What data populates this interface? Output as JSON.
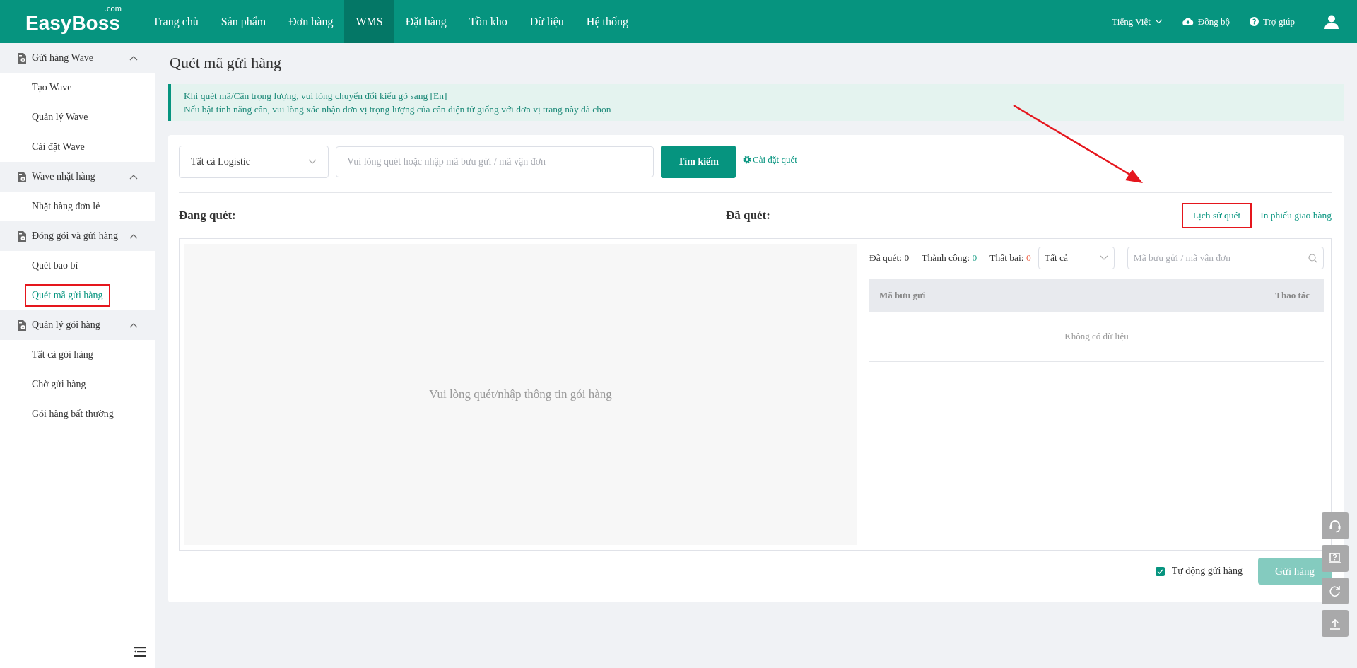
{
  "header": {
    "logo": "EasyBoss",
    "logo_suffix": ".com",
    "nav": [
      {
        "label": "Trang chủ",
        "selected": false
      },
      {
        "label": "Sản phẩm",
        "selected": false
      },
      {
        "label": "Đơn hàng",
        "selected": false
      },
      {
        "label": "WMS",
        "selected": true
      },
      {
        "label": "Đặt hàng",
        "selected": false
      },
      {
        "label": "Tồn kho",
        "selected": false
      },
      {
        "label": "Dữ liệu",
        "selected": false
      },
      {
        "label": "Hệ thống",
        "selected": false
      }
    ],
    "language": "Tiếng Việt",
    "sync": "Đồng bộ",
    "help": "Trợ giúp"
  },
  "sidebar": {
    "groups": [
      {
        "title": "Gửi hàng Wave",
        "expanded": true,
        "items": [
          {
            "label": "Tạo Wave",
            "selected": false,
            "highlighted": false
          },
          {
            "label": "Quản lý Wave",
            "selected": false,
            "highlighted": false
          },
          {
            "label": "Cài đặt Wave",
            "selected": false,
            "highlighted": false
          }
        ]
      },
      {
        "title": "Wave nhặt hàng",
        "expanded": true,
        "items": [
          {
            "label": "Nhặt hàng đơn lẻ",
            "selected": false,
            "highlighted": false
          }
        ]
      },
      {
        "title": "Đóng gói và gửi hàng",
        "expanded": true,
        "items": [
          {
            "label": "Quét bao bì",
            "selected": false,
            "highlighted": false
          },
          {
            "label": "Quét mã gửi hàng",
            "selected": true,
            "highlighted": true
          }
        ]
      },
      {
        "title": "Quản lý gói hàng",
        "expanded": true,
        "items": [
          {
            "label": "Tất cả gói hàng",
            "selected": false,
            "highlighted": false
          },
          {
            "label": "Chờ gửi hàng",
            "selected": false,
            "highlighted": false
          },
          {
            "label": "Gói hàng bất thường",
            "selected": false,
            "highlighted": false
          }
        ]
      }
    ]
  },
  "page": {
    "title": "Quét mã gửi hàng",
    "notice": [
      "Khi quét mã/Cân trọng lượng, vui lòng chuyển đổi kiểu gõ sang [En]",
      "Nếu bật tính năng cân, vui lòng xác nhận đơn vị trọng lượng của cân điện tử giống với đơn vị trang này đã chọn"
    ],
    "logistics_select": "Tất cả Logistic",
    "search": {
      "placeholder": "Vui lòng quét hoặc nhập mã bưu gửi / mã vận đơn"
    },
    "search_button": "Tìm kiếm",
    "scan_settings": "Cài đặt quét",
    "scanning": {
      "title": "Đang quét:",
      "empty": "Vui lòng quét/nhập thông tin gói hàng"
    },
    "scanned": {
      "title": "Đã quét:",
      "history_link": {
        "label": "Lịch sử quét",
        "highlighted": true
      },
      "print_link": "In phiếu giao hàng",
      "stats": [
        {
          "label": "Đã quét:",
          "value": "0",
          "kind": "neutral"
        },
        {
          "label": "Thành công:",
          "value": "0",
          "kind": "success"
        },
        {
          "label": "Thất bại:",
          "value": "0",
          "kind": "fail"
        }
      ],
      "filter": "Tất cả",
      "search": {
        "placeholder": "Mã bưu gửi / mã vận đơn"
      },
      "table": {
        "columns": [
          "Mã bưu gửi",
          "Thao tác"
        ],
        "empty": "Không có dữ liệu"
      }
    },
    "auto_send": {
      "label": "Tự động gửi hàng",
      "checked": true
    },
    "send_button": {
      "label": "Gửi hàng",
      "disabled": true
    }
  }
}
